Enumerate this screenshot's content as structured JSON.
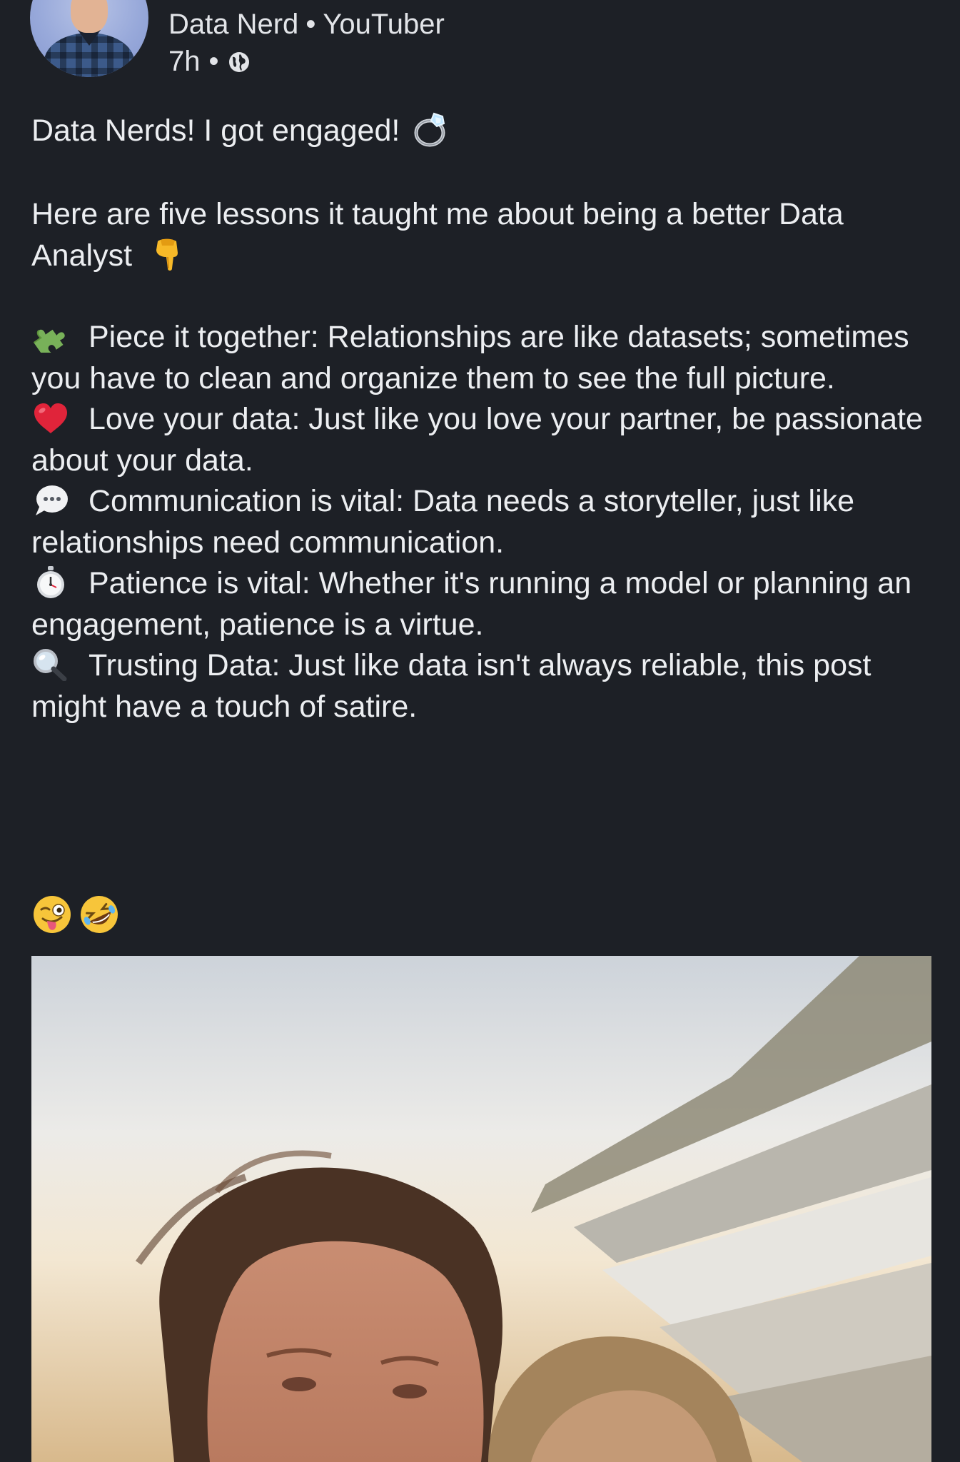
{
  "post": {
    "author": "Data Nerd",
    "headline": "YouTuber",
    "separator": "•",
    "time": "7h",
    "visibility_icon": "globe-icon",
    "paragraph1": "Data Nerds! I got engaged!",
    "paragraph1_emoji": "ring-icon",
    "paragraph2": "Here are five lessons it taught me about being a better Data Analyst",
    "paragraph2_emoji": "pointing-down-icon",
    "lessons": [
      {
        "icon": "puzzle-piece-icon",
        "text": "Piece it together: Relationships are like datasets; sometimes you have to clean and organize them to see the full picture."
      },
      {
        "icon": "red-heart-icon",
        "text": "Love your data: Just like you love your partner, be passionate about your data."
      },
      {
        "icon": "speech-bubble-icon",
        "text": "Communication is vital: Data needs a storyteller, just like relationships need communication."
      },
      {
        "icon": "stopwatch-icon",
        "text": "Patience is vital: Whether it's running a model or planning an engagement, patience is a virtue."
      },
      {
        "icon": "magnifying-glass-icon",
        "text": "Trusting Data: Just like data isn't always reliable, this post might have a touch of satire."
      }
    ],
    "closing_emojis": [
      "winking-tongue-face-icon",
      "rolling-laughing-face-icon"
    ],
    "photo": "selfie-photo"
  },
  "colors": {
    "background": "#1d2026",
    "text": "#eceef1",
    "heart": "#e0243a",
    "puzzle": "#78b159"
  }
}
